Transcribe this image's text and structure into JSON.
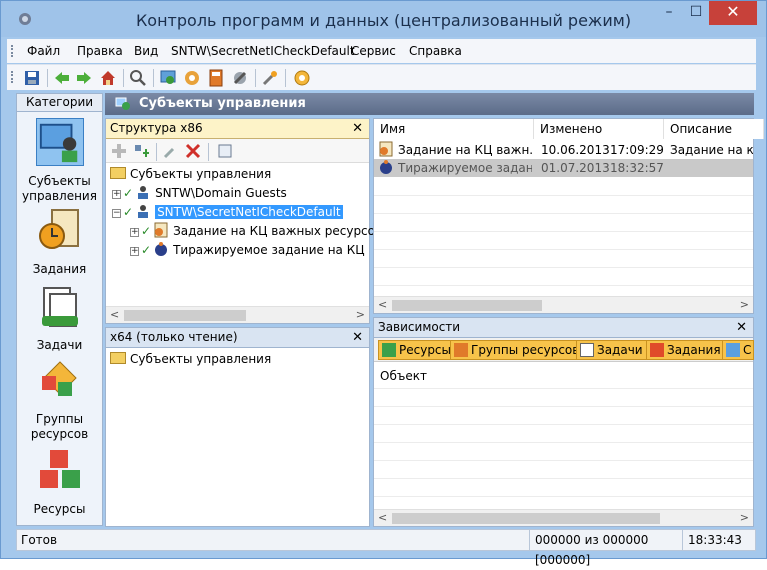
{
  "window": {
    "title": "Контроль программ и данных (централизованный режим)",
    "min": "–",
    "max": "☐",
    "close": "✕"
  },
  "menu": [
    "Файл",
    "Правка",
    "Вид",
    "SNTW\\SecretNetICheckDefault",
    "Сервис",
    "Справка"
  ],
  "toolbar_icons": [
    "save-icon",
    "back-icon",
    "forward-icon",
    "home-icon",
    "search-icon",
    "users-icon",
    "settings-icon",
    "calculator-icon",
    "tools-icon",
    "wrench-icon",
    "info-icon"
  ],
  "sidebar": {
    "header": "Категории",
    "items": [
      {
        "label": "Субъекты управления",
        "icon": "user-computer-icon",
        "selected": true
      },
      {
        "label": "Задания",
        "icon": "clock-clipboard-icon"
      },
      {
        "label": "Задачи",
        "icon": "documents-icon"
      },
      {
        "label": "Группы ресурсов",
        "icon": "cubes-group-icon"
      },
      {
        "label": "Ресурсы",
        "icon": "cubes-icon"
      }
    ]
  },
  "main_header": "Субъекты управления",
  "tree_panel": {
    "title": "Структура x86",
    "close": "✕",
    "nodes": [
      {
        "text": "Субъекты управления"
      },
      {
        "text": "SNTW\\Domain Guests"
      },
      {
        "text": "SNTW\\SecretNetICheckDefault"
      },
      {
        "text": "Задание на КЦ важных ресурсо"
      },
      {
        "text": "Тиражируемое задание на КЦ"
      }
    ]
  },
  "x64_panel": {
    "title": "x64 (только чтение)",
    "close": "✕",
    "nodes": [
      {
        "text": "Субъекты управления"
      }
    ]
  },
  "list_panel": {
    "columns": [
      "Имя",
      "Изменено",
      "Описание"
    ],
    "rows": [
      {
        "name": "Задание на КЦ важн...",
        "date": "10.06.2013",
        "time": "17:09:29",
        "desc": "Задание на ко"
      },
      {
        "name": "Тиражируемое задан...",
        "date": "01.07.2013",
        "time": "18:32:57",
        "desc": ""
      }
    ]
  },
  "deps_panel": {
    "title": "Зависимости",
    "close": "✕",
    "tabs": [
      "Ресурсы",
      "Группы ресурсов",
      "Задачи",
      "Задания",
      "С"
    ],
    "column": "Объект"
  },
  "status": {
    "text": "Готов",
    "count": "000000 из 000000 [000000]",
    "time": "18:33:43"
  },
  "colors": {
    "title_bg": "#9fc3e9",
    "close_btn": "#c7413a",
    "selection": "#3399ff",
    "dep_tab": "#f7c34a"
  }
}
